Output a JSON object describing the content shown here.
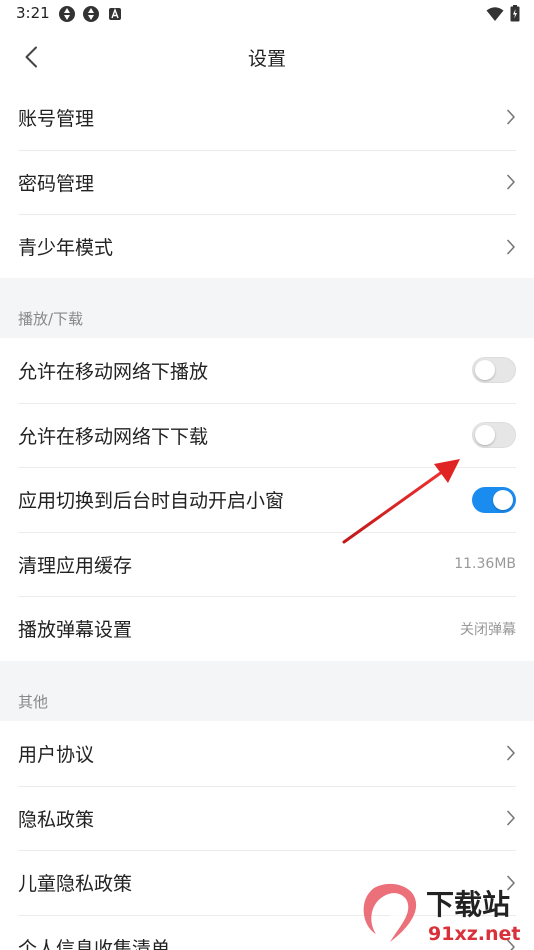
{
  "status_bar": {
    "time": "3:21",
    "left_icons": [
      "sync-icon",
      "sync-icon",
      "app-icon"
    ],
    "right_icons": [
      "wifi-icon",
      "battery-icon"
    ]
  },
  "nav": {
    "title": "设置",
    "back_icon": "chevron-left-icon"
  },
  "account_group": [
    {
      "label": "账号管理",
      "icon": "chevron-right-icon"
    },
    {
      "label": "密码管理",
      "icon": "chevron-right-icon"
    },
    {
      "label": "青少年模式",
      "icon": "chevron-right-icon"
    }
  ],
  "play_section": {
    "header": "播放/下载",
    "rows": [
      {
        "label": "允许在移动网络下播放",
        "toggle": "off"
      },
      {
        "label": "允许在移动网络下下载",
        "toggle": "off"
      },
      {
        "label": "应用切换到后台时自动开启小窗",
        "toggle": "on"
      },
      {
        "label": "清理应用缓存",
        "value": "11.36MB"
      },
      {
        "label": "播放弹幕设置",
        "value": "关闭弹幕"
      }
    ]
  },
  "other_section": {
    "header": "其他",
    "rows": [
      {
        "label": "用户协议",
        "icon": "chevron-right-icon"
      },
      {
        "label": "隐私政策",
        "icon": "chevron-right-icon"
      },
      {
        "label": "儿童隐私政策",
        "icon": "chevron-right-icon"
      },
      {
        "label": "个人信息收集清单",
        "icon": "chevron-right-icon"
      }
    ]
  },
  "watermark": {
    "logo_text": "9",
    "title": "下载站",
    "url": "91xz.net"
  },
  "colors": {
    "accent": "#1a8cf0",
    "section_bg": "#f4f5f7",
    "annotation_arrow": "#e02424"
  }
}
